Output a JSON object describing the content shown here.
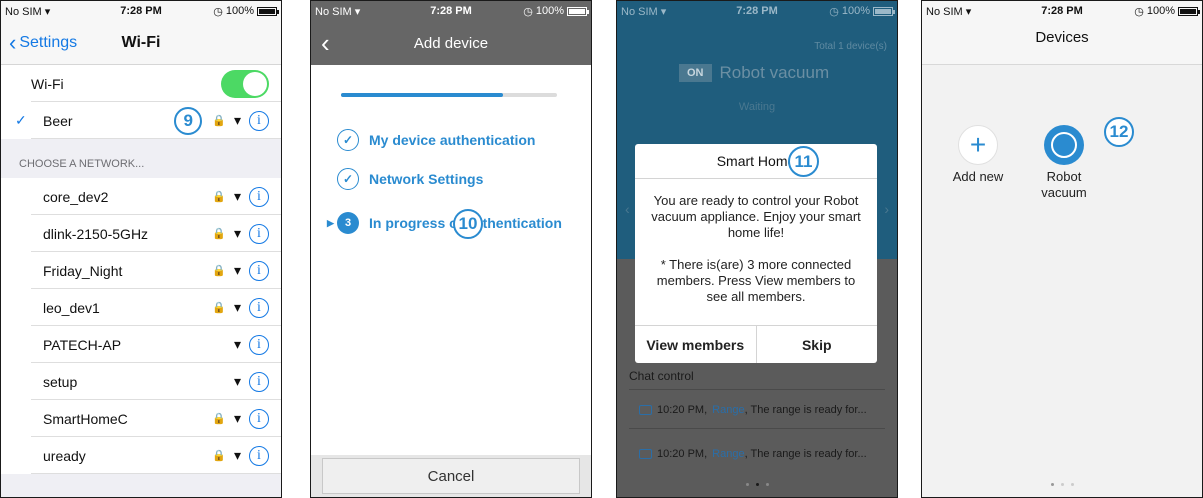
{
  "status": {
    "carrier": "No SIM",
    "time": "7:28 PM",
    "battery": "100%"
  },
  "wifi_screen": {
    "back_label": "Settings",
    "title": "Wi-Fi",
    "wifi_label": "Wi-Fi",
    "wifi_on": true,
    "connected": {
      "name": "Beer",
      "marker": "9"
    },
    "section_header": "CHOOSE A NETWORK...",
    "networks": [
      {
        "name": "core_dev2",
        "locked": true
      },
      {
        "name": "dlink-2150-5GHz",
        "locked": true
      },
      {
        "name": "Friday_Night",
        "locked": true
      },
      {
        "name": "leo_dev1",
        "locked": true
      },
      {
        "name": "PATECH-AP",
        "locked": false
      },
      {
        "name": "setup",
        "locked": false
      },
      {
        "name": "SmartHomeC",
        "locked": true
      },
      {
        "name": "uready",
        "locked": true
      }
    ]
  },
  "add_device_screen": {
    "title": "Add device",
    "progress": 0.75,
    "steps": [
      {
        "label": "My device authentication",
        "state": "done"
      },
      {
        "label": "Network Settings",
        "state": "done"
      },
      {
        "label": "In progress of authentication",
        "state": "current",
        "number": "3"
      }
    ],
    "marker": "10",
    "cancel_label": "Cancel"
  },
  "robot_screen": {
    "total_label": "Total 1 device(s)",
    "on_label": "ON",
    "device_name": "Robot vacuum",
    "status": "Waiting",
    "dialog": {
      "title": "Smart Home",
      "marker": "11",
      "message": "You are ready to control your Robot vacuum appliance. Enjoy your smart home life!",
      "note": "* There is(are) 3 more connected members. Press View members to see all members.",
      "view_members_label": "View members",
      "skip_label": "Skip"
    },
    "chat_header": "Chat control",
    "chat_items": [
      {
        "time": "10:20 PM,",
        "sender": "Range",
        "text": ", The range is ready for..."
      },
      {
        "time": "10:20 PM,",
        "sender": "Range",
        "text": ", The range is ready for..."
      }
    ]
  },
  "devices_screen": {
    "title": "Devices",
    "add_new_label": "Add new",
    "device_label": "Robot vacuum",
    "marker": "12"
  },
  "colors": {
    "accent": "#2a8bd0",
    "ios_blue": "#1479e4",
    "toggle_on": "#4cd964"
  }
}
